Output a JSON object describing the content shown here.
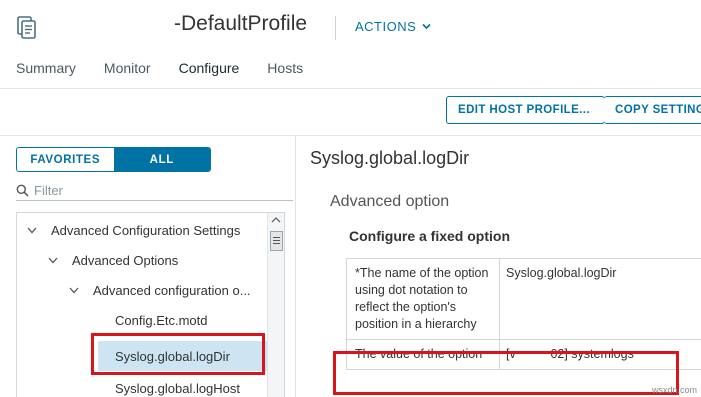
{
  "header": {
    "title": "-DefaultProfile",
    "actions_label": "ACTIONS"
  },
  "tabs": [
    {
      "label": "Summary"
    },
    {
      "label": "Monitor"
    },
    {
      "label": "Configure",
      "active": true
    },
    {
      "label": "Hosts"
    }
  ],
  "toolbar": {
    "edit_label": "EDIT HOST PROFILE...",
    "copy_label": "COPY SETTINGS"
  },
  "left_pane": {
    "segmented": {
      "favorites": "FAVORITES",
      "all": "ALL",
      "selected": "ALL"
    },
    "filter_placeholder": "Filter",
    "tree": [
      {
        "label": "Advanced Configuration Settings",
        "expanded": true
      },
      {
        "label": "Advanced Options",
        "expanded": true
      },
      {
        "label": "Advanced configuration o...",
        "expanded": true
      },
      {
        "label": "Config.Etc.motd"
      },
      {
        "label": "Syslog.global.logDir",
        "selected": true
      },
      {
        "label": "Syslog.global.logHost"
      }
    ]
  },
  "right_pane": {
    "heading": "Syslog.global.logDir",
    "subheading": "Advanced option",
    "section_title": "Configure a fixed option",
    "rows": [
      {
        "label": "*The name of the option using dot notation to reflect the option's position in a hierarchy",
        "value": "Syslog.global.logDir"
      },
      {
        "label": "The value of the option",
        "value": "[v          02] systemlogs"
      }
    ]
  },
  "watermark": "wsxdn.com",
  "colors": {
    "accent": "#0072a3",
    "highlight_box": "#d9151c",
    "selection": "#cde5f3"
  }
}
